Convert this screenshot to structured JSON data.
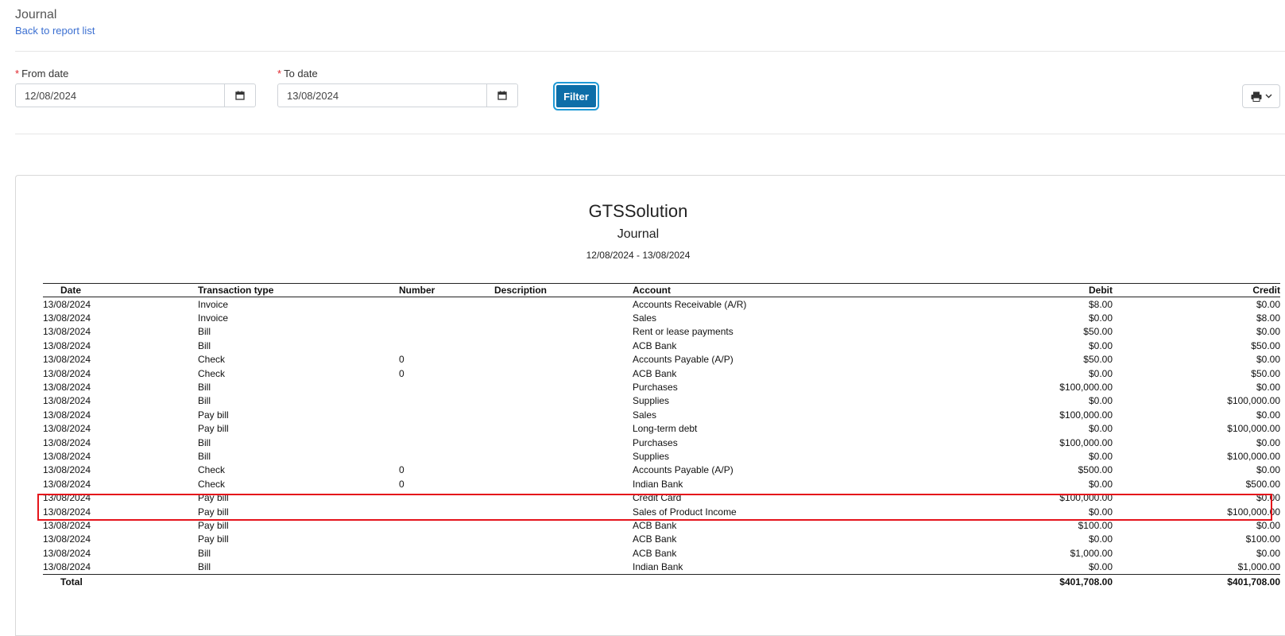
{
  "header": {
    "title": "Journal",
    "back_link": "Back to report list"
  },
  "filters": {
    "from_label": "From date",
    "from_value": "12/08/2024",
    "to_label": "To date",
    "to_value": "13/08/2024",
    "required_marker": "*",
    "filter_button": "Filter"
  },
  "report": {
    "company": "GTSSolution",
    "title": "Journal",
    "date_range": "12/08/2024 - 13/08/2024",
    "columns": [
      "Date",
      "Transaction type",
      "Number",
      "Description",
      "Account",
      "Debit",
      "Credit"
    ],
    "rows": [
      [
        "13/08/2024",
        "Invoice",
        "",
        "",
        "Accounts Receivable (A/R)",
        "$8.00",
        "$0.00"
      ],
      [
        "13/08/2024",
        "Invoice",
        "",
        "",
        "Sales",
        "$0.00",
        "$8.00"
      ],
      [
        "13/08/2024",
        "Bill",
        "",
        "",
        "Rent or lease payments",
        "$50.00",
        "$0.00"
      ],
      [
        "13/08/2024",
        "Bill",
        "",
        "",
        "ACB Bank",
        "$0.00",
        "$50.00"
      ],
      [
        "13/08/2024",
        "Check",
        "0",
        "",
        "Accounts Payable (A/P)",
        "$50.00",
        "$0.00"
      ],
      [
        "13/08/2024",
        "Check",
        "0",
        "",
        "ACB Bank",
        "$0.00",
        "$50.00"
      ],
      [
        "13/08/2024",
        "Bill",
        "",
        "",
        "Purchases",
        "$100,000.00",
        "$0.00"
      ],
      [
        "13/08/2024",
        "Bill",
        "",
        "",
        "Supplies",
        "$0.00",
        "$100,000.00"
      ],
      [
        "13/08/2024",
        "Pay bill",
        "",
        "",
        "Sales",
        "$100,000.00",
        "$0.00"
      ],
      [
        "13/08/2024",
        "Pay bill",
        "",
        "",
        "Long-term debt",
        "$0.00",
        "$100,000.00"
      ],
      [
        "13/08/2024",
        "Bill",
        "",
        "",
        "Purchases",
        "$100,000.00",
        "$0.00"
      ],
      [
        "13/08/2024",
        "Bill",
        "",
        "",
        "Supplies",
        "$0.00",
        "$100,000.00"
      ],
      [
        "13/08/2024",
        "Check",
        "0",
        "",
        "Accounts Payable (A/P)",
        "$500.00",
        "$0.00"
      ],
      [
        "13/08/2024",
        "Check",
        "0",
        "",
        "Indian Bank",
        "$0.00",
        "$500.00"
      ],
      [
        "13/08/2024",
        "Pay bill",
        "",
        "",
        "Credit Card",
        "$100,000.00",
        "$0.00"
      ],
      [
        "13/08/2024",
        "Pay bill",
        "",
        "",
        "Sales of Product Income",
        "$0.00",
        "$100,000.00"
      ],
      [
        "13/08/2024",
        "Pay bill",
        "",
        "",
        "ACB Bank",
        "$100.00",
        "$0.00"
      ],
      [
        "13/08/2024",
        "Pay bill",
        "",
        "",
        "ACB Bank",
        "$0.00",
        "$100.00"
      ],
      [
        "13/08/2024",
        "Bill",
        "",
        "",
        "ACB Bank",
        "$1,000.00",
        "$0.00"
      ],
      [
        "13/08/2024",
        "Bill",
        "",
        "",
        "Indian Bank",
        "$0.00",
        "$1,000.00"
      ]
    ],
    "total_label": "Total",
    "total_debit": "$401,708.00",
    "total_credit": "$401,708.00"
  },
  "icons": {
    "calendar": "calendar-icon",
    "print": "print-icon",
    "chevron": "chevron-down-icon"
  },
  "colors": {
    "link": "#3b6fd1",
    "primary_button": "#0d6ea8",
    "required": "#e0242b",
    "highlight": "#e5141b"
  }
}
